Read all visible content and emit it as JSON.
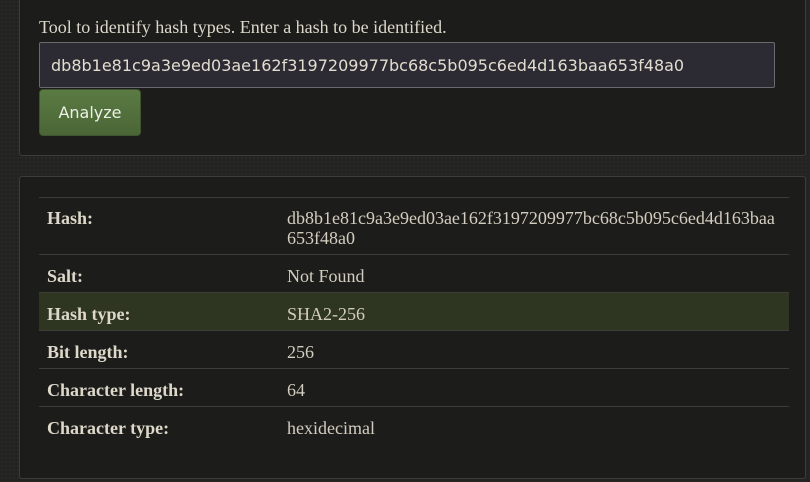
{
  "form": {
    "description": "Tool to identify hash types. Enter a hash to be identified.",
    "hash_value": "db8b1e81c9a3e9ed03ae162f3197209977bc68c5b095c6ed4d163baa653f48a0",
    "analyze_label": "Analyze"
  },
  "result": {
    "rows": [
      {
        "label": "Hash:",
        "value": "db8b1e81c9a3e9ed03ae162f3197209977bc68c5b095c6ed4d163baa653f48a0"
      },
      {
        "label": "Salt:",
        "value": "Not Found"
      },
      {
        "label": "Hash type:",
        "value": "SHA2-256"
      },
      {
        "label": "Bit length:",
        "value": "256"
      },
      {
        "label": "Character length:",
        "value": "64"
      },
      {
        "label": "Character type:",
        "value": "hexidecimal"
      }
    ]
  },
  "colors": {
    "button": "#527240",
    "highlight_row": "#2e3520",
    "background": "#232321"
  }
}
